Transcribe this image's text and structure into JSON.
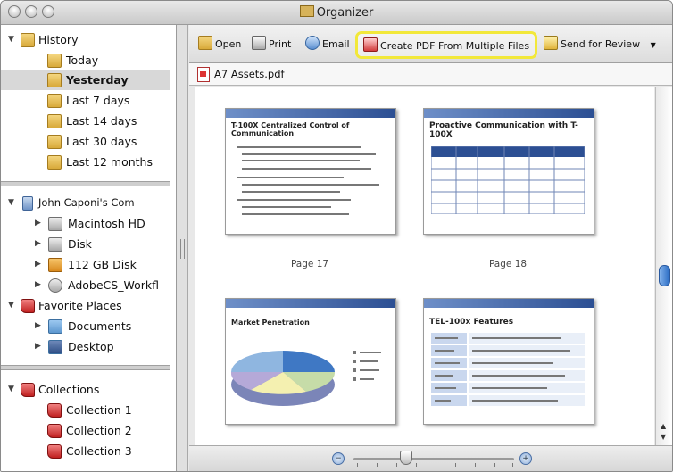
{
  "window": {
    "title": "Organizer"
  },
  "sidebar": {
    "history": {
      "label": "History",
      "items": [
        "Today",
        "Yesterday",
        "Last 7 days",
        "Last 14 days",
        "Last 30 days",
        "Last 12 months"
      ],
      "selected": "Yesterday"
    },
    "computer": {
      "label": "John Caponi's Com",
      "items": [
        "Macintosh HD",
        "Disk",
        "112 GB Disk",
        "AdobeCS_Workfl"
      ]
    },
    "favorites": {
      "label": "Favorite Places",
      "items": [
        "Documents",
        "Desktop"
      ]
    },
    "collections": {
      "label": "Collections",
      "items": [
        "Collection 1",
        "Collection 2",
        "Collection 3"
      ]
    }
  },
  "toolbar": {
    "open": "Open",
    "print": "Print",
    "email": "Email",
    "create_pdf": "Create PDF From Multiple Files",
    "send_review": "Send for Review"
  },
  "document": {
    "name": "A7 Assets.pdf"
  },
  "pages": [
    {
      "label": "Page 17",
      "title": "T-100X  Centralized Control of Communication"
    },
    {
      "label": "Page 18",
      "title": "Proactive Communication with T-100X"
    },
    {
      "label": "",
      "title": "Market Penetration"
    },
    {
      "label": "",
      "title": "TEL-100x Features"
    }
  ],
  "colors": {
    "highlight": "#f2e83a",
    "slide_band": "#2c4f93",
    "scroll_thumb": "#2b6cc4"
  }
}
